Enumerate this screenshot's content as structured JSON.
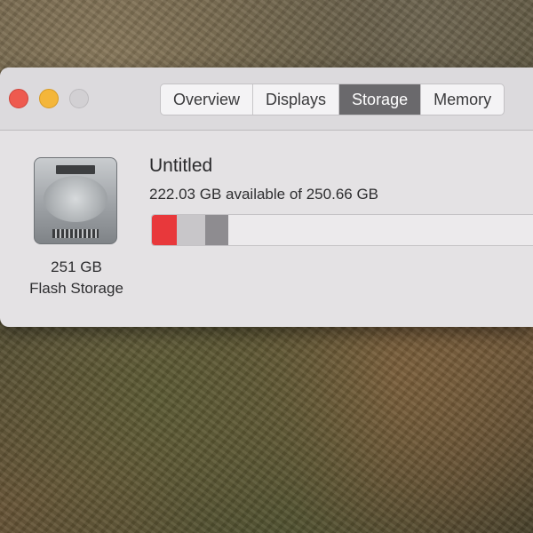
{
  "window": {
    "traffic_lights": [
      {
        "name": "close",
        "color": "#ee5a4f"
      },
      {
        "name": "minimize",
        "color": "#f4b63a"
      },
      {
        "name": "zoom",
        "color": "#d2d0d3"
      }
    ]
  },
  "tabs": [
    {
      "label": "Overview",
      "active": false
    },
    {
      "label": "Displays",
      "active": false
    },
    {
      "label": "Storage",
      "active": true
    },
    {
      "label": "Memory",
      "active": false
    }
  ],
  "disk": {
    "icon": "hard-drive-icon",
    "capacity": "251 GB",
    "type": "Flash Storage"
  },
  "volume": {
    "name": "Untitled",
    "availability": "222.03 GB available of 250.66 GB",
    "total_gb": 250.66,
    "available_gb": 222.03
  },
  "usage_segments": [
    {
      "color": "#e8383b",
      "fraction": 0.065
    },
    {
      "color": "#c8c6c9",
      "fraction": 0.075
    },
    {
      "color": "#8e8c90",
      "fraction": 0.06
    }
  ]
}
